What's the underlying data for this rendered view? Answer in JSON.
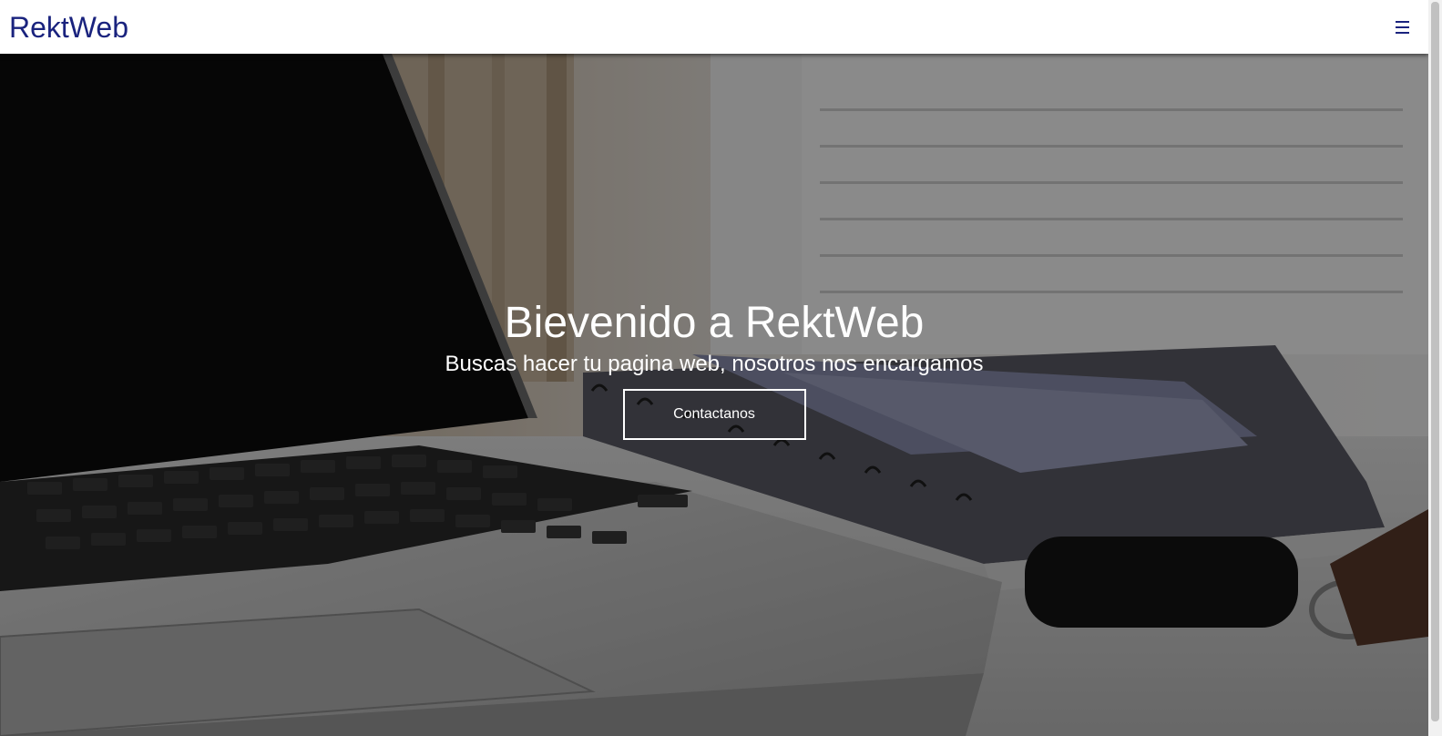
{
  "navbar": {
    "brand": "RektWeb",
    "menu_icon": "hamburger-menu-icon"
  },
  "hero": {
    "background_image": "laptop-desk-photo",
    "title": "Bievenido a RektWeb",
    "subtitle": "Buscas hacer tu pagina web, nosotros nos encargamos",
    "cta_label": "Contactanos"
  },
  "colors": {
    "brand": "#1a237e",
    "navbar_bg": "#ffffff",
    "hero_text": "#ffffff",
    "hero_overlay": "rgba(0,0,0,0.45)"
  }
}
